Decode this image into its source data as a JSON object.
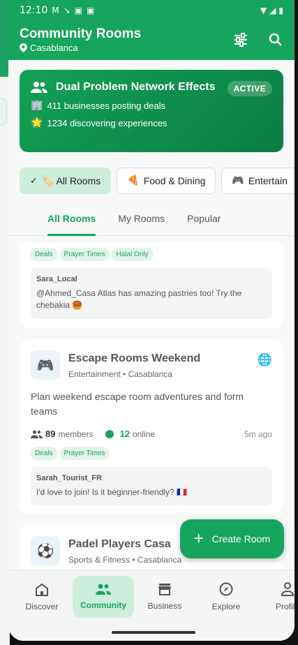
{
  "statusbar": {
    "time": "12:10"
  },
  "appbar": {
    "title": "Community Rooms",
    "location": "Casablanca"
  },
  "hero": {
    "title": "Dual Problem Network Effects",
    "badge": "ACTIVE",
    "stat1": "411 businesses posting deals",
    "stat2": "1234 discovering experiences"
  },
  "filters": [
    {
      "label": "🏷️ All Rooms",
      "selected": true
    },
    {
      "label": "Food & Dining",
      "emoji": "🍕"
    },
    {
      "label": "Entertain",
      "emoji": "🎮"
    }
  ],
  "tabs": [
    "All Rooms",
    "My Rooms",
    "Popular"
  ],
  "card1": {
    "tags": [
      "Deals",
      "Prayer Times",
      "Halal Only"
    ],
    "comment_user": "Sara_Local",
    "comment_text": "@Ahmed_Casa Atlas has amazing pastries too! Try the chebakia 🥮"
  },
  "card2": {
    "name": "Escape Rooms Weekend",
    "subtitle": "Entertainment • Casablanca",
    "description": "Plan weekend escape room adventures and form teams",
    "members_count": "89",
    "members_label": "members",
    "online_count": "12",
    "online_label": "online",
    "time_ago": "5m ago",
    "tags": [
      "Deals",
      "Prayer Times"
    ],
    "comment_user": "Sarah_Tourist_FR",
    "comment_text": "I'd love to join! Is it beginner-friendly? 🇫🇷"
  },
  "card3": {
    "name": "Padel Players Casa",
    "subtitle": "Sports & Fitness • Casablanca"
  },
  "fab": {
    "label": "Create Room"
  },
  "nav": [
    "Discover",
    "Community",
    "Business",
    "Explore",
    "Profile"
  ]
}
